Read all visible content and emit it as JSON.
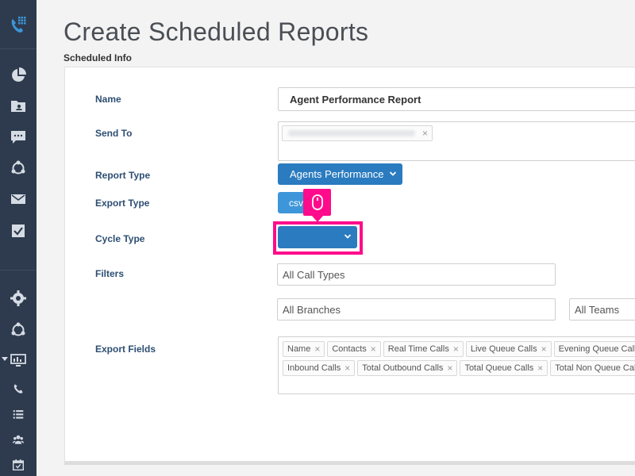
{
  "page": {
    "title": "Create Scheduled Reports",
    "section": "Scheduled Info"
  },
  "form": {
    "name_label": "Name",
    "name_value": "Agent Performance Report",
    "send_to_label": "Send To",
    "report_type_label": "Report Type",
    "report_type_value": "Agents Performance",
    "export_type_label": "Export Type",
    "export_type_value": "csv",
    "cycle_type_label": "Cycle Type",
    "cycle_type_value": "",
    "filters_label": "Filters",
    "filter_call_types": "All Call Types",
    "filter_branches": "All Branches",
    "filter_teams": "All Teams",
    "export_fields_label": "Export Fields",
    "export_fields_row1": [
      "Name",
      "Contacts",
      "Real Time Calls",
      "Live Queue Calls",
      "Evening Queue Calls"
    ],
    "export_fields_row2": [
      "Inbound Calls",
      "Total Outbound Calls",
      "Total Queue Calls",
      "Total Non Queue Calls"
    ]
  },
  "colors": {
    "sidebar": "#2e3b4e",
    "primary_button": "#2a7bbf",
    "highlight": "#ff0b8c",
    "label": "#2d4e73"
  },
  "icons": {
    "sidebar": [
      "phone-logo-icon",
      "pie-chart-icon",
      "contacts-folder-icon",
      "chat-icon",
      "integrations-icon",
      "mail-icon",
      "checkbox-icon",
      "settings-icon",
      "integrations-icon",
      "monitor-icon",
      "phone-icon",
      "list-icon",
      "users-icon",
      "calendar-icon"
    ],
    "tooltip": "mouse-icon"
  }
}
